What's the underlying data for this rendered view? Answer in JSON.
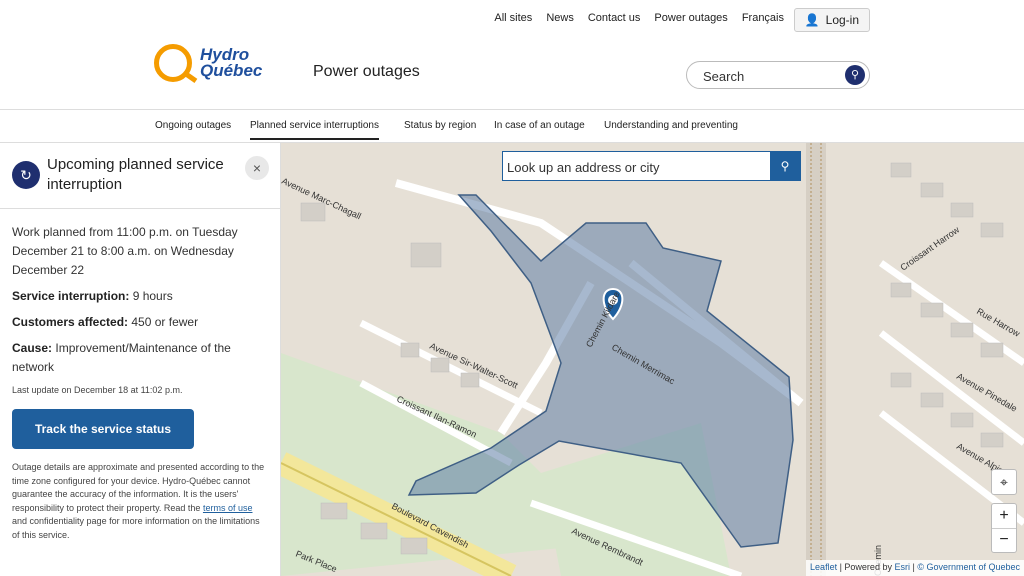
{
  "header": {
    "utility_links": [
      "All sites",
      "News",
      "Contact us",
      "Power outages",
      "Français"
    ],
    "login_label": "Log-in",
    "logo_text": "Hydro Québec",
    "section_title": "Power outages",
    "search_placeholder": "Search"
  },
  "nav": {
    "items": [
      "Ongoing outages",
      "Planned service interruptions",
      "Status by region",
      "In case of an outage",
      "Understanding and preventing"
    ]
  },
  "panel": {
    "title": "Upcoming planned service interruption",
    "work": "Work planned from 11:00 p.m. on Tuesday December 21 to 8:00 a.m. on Wednesday December 22",
    "interruption_label": "Service interruption:",
    "interruption_value": "9 hours",
    "customers_label": "Customers affected:",
    "customers_value": "450 or fewer",
    "cause_label": "Cause:",
    "cause_value": "Improvement/Maintenance of the network",
    "last_update": "Last update on December 18 at 11:02 p.m.",
    "track_button": "Track the service status",
    "disclaimer_pre": "Outage details are approximate and presented according to the time zone configured for your device. Hydro-Québec cannot guarantee the accuracy of the information. It is the users' responsibility to protect their property. Read the",
    "disclaimer_link": "terms of use",
    "disclaimer_post": "and confidentiality page for more information on the limitations of this service."
  },
  "map": {
    "search_placeholder": "Look up an address or city",
    "street_labels": [
      "Avenue Marc-Chagall",
      "Avenue Sir-Walter-Scott",
      "Croissant Ilan-Ramon",
      "Chemin Kildare",
      "Chemin Merrimac",
      "Croissant Harrow",
      "Rue Harrow",
      "Avenue Pinedale",
      "Avenue Alpine",
      "Avenue Rembrandt",
      "Boulevard Cavendish",
      "Park Place",
      "Chemin"
    ],
    "attribution_leaflet": "Leaflet",
    "attribution_powered": "Powered by",
    "attribution_esri": "Esri",
    "attribution_gov": "© Government of Quebec",
    "zoom_in": "+",
    "zoom_out": "−"
  }
}
